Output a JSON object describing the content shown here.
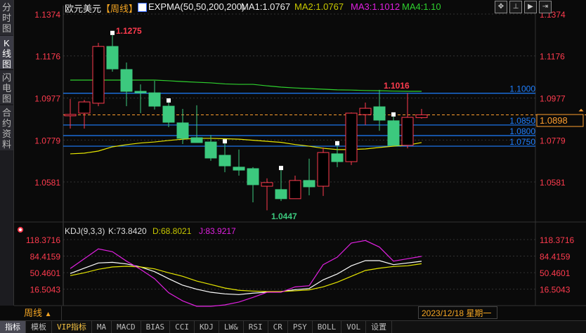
{
  "left_tabs": [
    {
      "label": "分时图"
    },
    {
      "label": "K线图",
      "active": true
    },
    {
      "label": "闪电图"
    },
    {
      "label": "合约资料"
    }
  ],
  "header": {
    "symbol": "欧元美元",
    "period_tag": "【周线】",
    "indicator": "EXPMA(50,50,200,200)",
    "ma1": "MA1:1.0767",
    "ma2": "MA2:1.0767",
    "ma3": "MA3:1.1012",
    "ma4": "MA4:1.10",
    "icons": [
      "move-icon",
      "fit-icon",
      "play-icon",
      "exit-icon"
    ]
  },
  "colors": {
    "up": "#ff3b4e",
    "down": "#3cc97e",
    "ma1": "#ffffff",
    "ma2": "#e6e600",
    "ma3": "#e020e0",
    "ma4": "#2ed12e",
    "hline": "#1e7fff",
    "axis_label": "#ff3b4e",
    "current": "#ff9f2e"
  },
  "kdj": {
    "label": "KDJ(9,3,3)",
    "k": "K:73.8420",
    "d": "D:68.8021",
    "j": "J:83.9217"
  },
  "footer": {
    "period": "周线",
    "period_arrow": "▲",
    "date": "2023/12/18 星期一"
  },
  "bottom_tabs": [
    {
      "label": "指标",
      "active": true
    },
    {
      "label": "模板"
    },
    {
      "label": "VIP指标",
      "vip": true
    },
    {
      "label": "MA"
    },
    {
      "label": "MACD"
    },
    {
      "label": "BIAS"
    },
    {
      "label": "CCI"
    },
    {
      "label": "KDJ"
    },
    {
      "label": "LW&"
    },
    {
      "label": "RSI"
    },
    {
      "label": "CR"
    },
    {
      "label": "PSY"
    },
    {
      "label": "BOLL"
    },
    {
      "label": "VOL"
    },
    {
      "label": "设置"
    }
  ],
  "chart_data": [
    {
      "type": "candlestick",
      "title": "欧元美元 周线",
      "ylim": [
        1.0447,
        1.1374
      ],
      "y_ticks": [
        "1.1374",
        "1.1176",
        "1.0977",
        "1.0779",
        "1.0581"
      ],
      "grid": true,
      "high_label": "1.1275",
      "low_label": "1.0447",
      "local_high_label": "1.1016",
      "current_price": "1.0898",
      "candles": [
        [
          1.09,
          1.0973,
          1.0833,
          1.09
        ],
        [
          1.0906,
          1.0969,
          1.0833,
          1.0959
        ],
        [
          1.0953,
          1.1238,
          1.0939,
          1.1221
        ],
        [
          1.1221,
          1.1275,
          1.1102,
          1.1115
        ],
        [
          1.1112,
          1.1145,
          1.0939,
          1.1009
        ],
        [
          1.1009,
          1.1042,
          1.0906,
          1.1002
        ],
        [
          1.1002,
          1.1059,
          1.0923,
          1.0939
        ],
        [
          1.0939,
          1.0956,
          1.084,
          1.0863
        ],
        [
          1.086,
          1.0926,
          1.076,
          1.0787
        ],
        [
          1.079,
          1.0943,
          1.0767,
          1.0767
        ],
        [
          1.077,
          1.0803,
          1.0681,
          1.0694
        ],
        [
          1.0707,
          1.0763,
          1.0627,
          1.0657
        ],
        [
          1.0651,
          1.0734,
          1.0611,
          1.0637
        ],
        [
          1.0644,
          1.0651,
          1.0485,
          1.0568
        ],
        [
          1.0561,
          1.0598,
          1.0447,
          1.0578
        ],
        [
          1.0545,
          1.0637,
          1.0491,
          1.0502
        ],
        [
          1.0502,
          1.0611,
          1.0502,
          1.0588
        ],
        [
          1.0588,
          1.0691,
          1.0518,
          1.0558
        ],
        [
          1.0561,
          1.0744,
          1.0515,
          1.072
        ],
        [
          1.0714,
          1.0754,
          1.0651,
          1.0677
        ],
        [
          1.0677,
          1.0909,
          1.0661,
          1.0906
        ],
        [
          1.0899,
          1.0956,
          1.085,
          1.0929
        ],
        [
          1.0936,
          1.1016,
          1.0823,
          1.0873
        ],
        [
          1.087,
          1.089,
          1.0754,
          1.0754
        ],
        [
          1.0754,
          1.1,
          1.074,
          1.0886
        ],
        [
          1.0885,
          1.0926,
          1.088,
          1.0898
        ]
      ],
      "signal_marks": [
        3,
        7,
        11,
        15,
        19,
        23
      ],
      "ma_yellow": [
        1.0714,
        1.0717,
        1.0727,
        1.0747,
        1.0757,
        1.0765,
        1.077,
        1.0777,
        1.0783,
        1.0787,
        1.0787,
        1.0785,
        1.0783,
        1.0778,
        1.0773,
        1.0768,
        1.0758,
        1.075,
        1.074,
        1.0734,
        1.0734,
        1.0737,
        1.0744,
        1.075,
        1.0755,
        1.0767
      ],
      "ma_green": [
        1.1062,
        1.1062,
        1.1062,
        1.1062,
        1.1062,
        1.1062,
        1.1062,
        1.1059,
        1.1055,
        1.1052,
        1.1049,
        1.1044,
        1.1042,
        1.1042,
        1.1035,
        1.1029,
        1.1025,
        1.1022,
        1.1019,
        1.1016,
        1.1015,
        1.1013,
        1.1012,
        1.101,
        1.1009,
        1.1009
      ],
      "horizontal_lines": [
        {
          "value": 1.1,
          "label": "1.1000"
        },
        {
          "value": 1.085,
          "label": "1.0850"
        },
        {
          "value": 1.08,
          "label": "1.0800"
        },
        {
          "value": 1.075,
          "label": "1.0750"
        }
      ]
    },
    {
      "type": "line",
      "title": "KDJ(9,3,3)",
      "ylim": [
        16.5043,
        118.3716
      ],
      "y_ticks": [
        "118.3716",
        "84.4159",
        "50.4601",
        "16.5043"
      ],
      "series": [
        {
          "name": "K",
          "values": [
            48.7,
            59.6,
            70.3,
            71.7,
            68.3,
            62.1,
            52.4,
            38,
            24.6,
            16.4,
            10.1,
            6.8,
            5.4,
            8.3,
            10.1,
            11.6,
            15.5,
            17.8,
            35.7,
            47.7,
            64.5,
            75.1,
            75.1,
            66.9,
            70.3,
            73.84
          ]
        },
        {
          "name": "D",
          "values": [
            44.3,
            50.1,
            57.3,
            62.1,
            63.5,
            62.1,
            58.2,
            50.1,
            42.9,
            33.2,
            26.1,
            18.8,
            14.1,
            12.6,
            11.6,
            11.6,
            13.1,
            15,
            21.2,
            30.8,
            42.9,
            54.9,
            59.6,
            63.1,
            64.5,
            68.8
          ]
        },
        {
          "name": "J",
          "values": [
            58.8,
            79,
            99.2,
            93.4,
            74.1,
            57.3,
            38,
            9.2,
            -7.6,
            -18.7,
            -18.7,
            -15.8,
            -10,
            -0.4,
            10.1,
            10.1,
            21.2,
            23.6,
            66.9,
            82.3,
            111.2,
            116.5,
            103,
            74.1,
            79,
            83.92
          ]
        }
      ]
    }
  ]
}
